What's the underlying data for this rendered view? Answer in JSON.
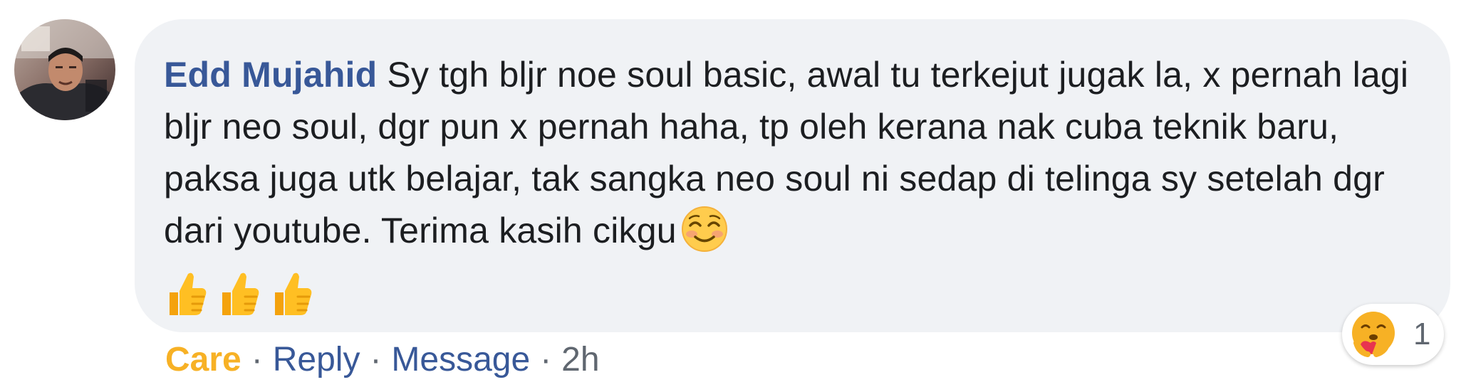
{
  "comment": {
    "author": "Edd Mujahid",
    "text": "Sy tgh bljr noe soul basic, awal tu terkejut jugak la, x pernah lagi bljr neo soul, dgr pun x pernah haha, tp oleh kerana nak cuba teknik baru, paksa juga utk belajar, tak sangka neo soul ni sedap di telinga sy setelah dgr dari youtube. Terima kasih cikgu",
    "trailing_emoji": "smiling-blushing-face",
    "thumbs_emoji": [
      "thumbs-up",
      "thumbs-up",
      "thumbs-up"
    ]
  },
  "actions": {
    "care_label": "Care",
    "separator": "·",
    "reply_label": "Reply",
    "message_label": "Message",
    "timestamp": "2h"
  },
  "reactions": {
    "type": "care",
    "count": "1"
  },
  "colors": {
    "author": "#385898",
    "care": "#f7b125",
    "bubble": "#f0f2f5",
    "text": "#1c1e21",
    "meta": "#606770"
  }
}
